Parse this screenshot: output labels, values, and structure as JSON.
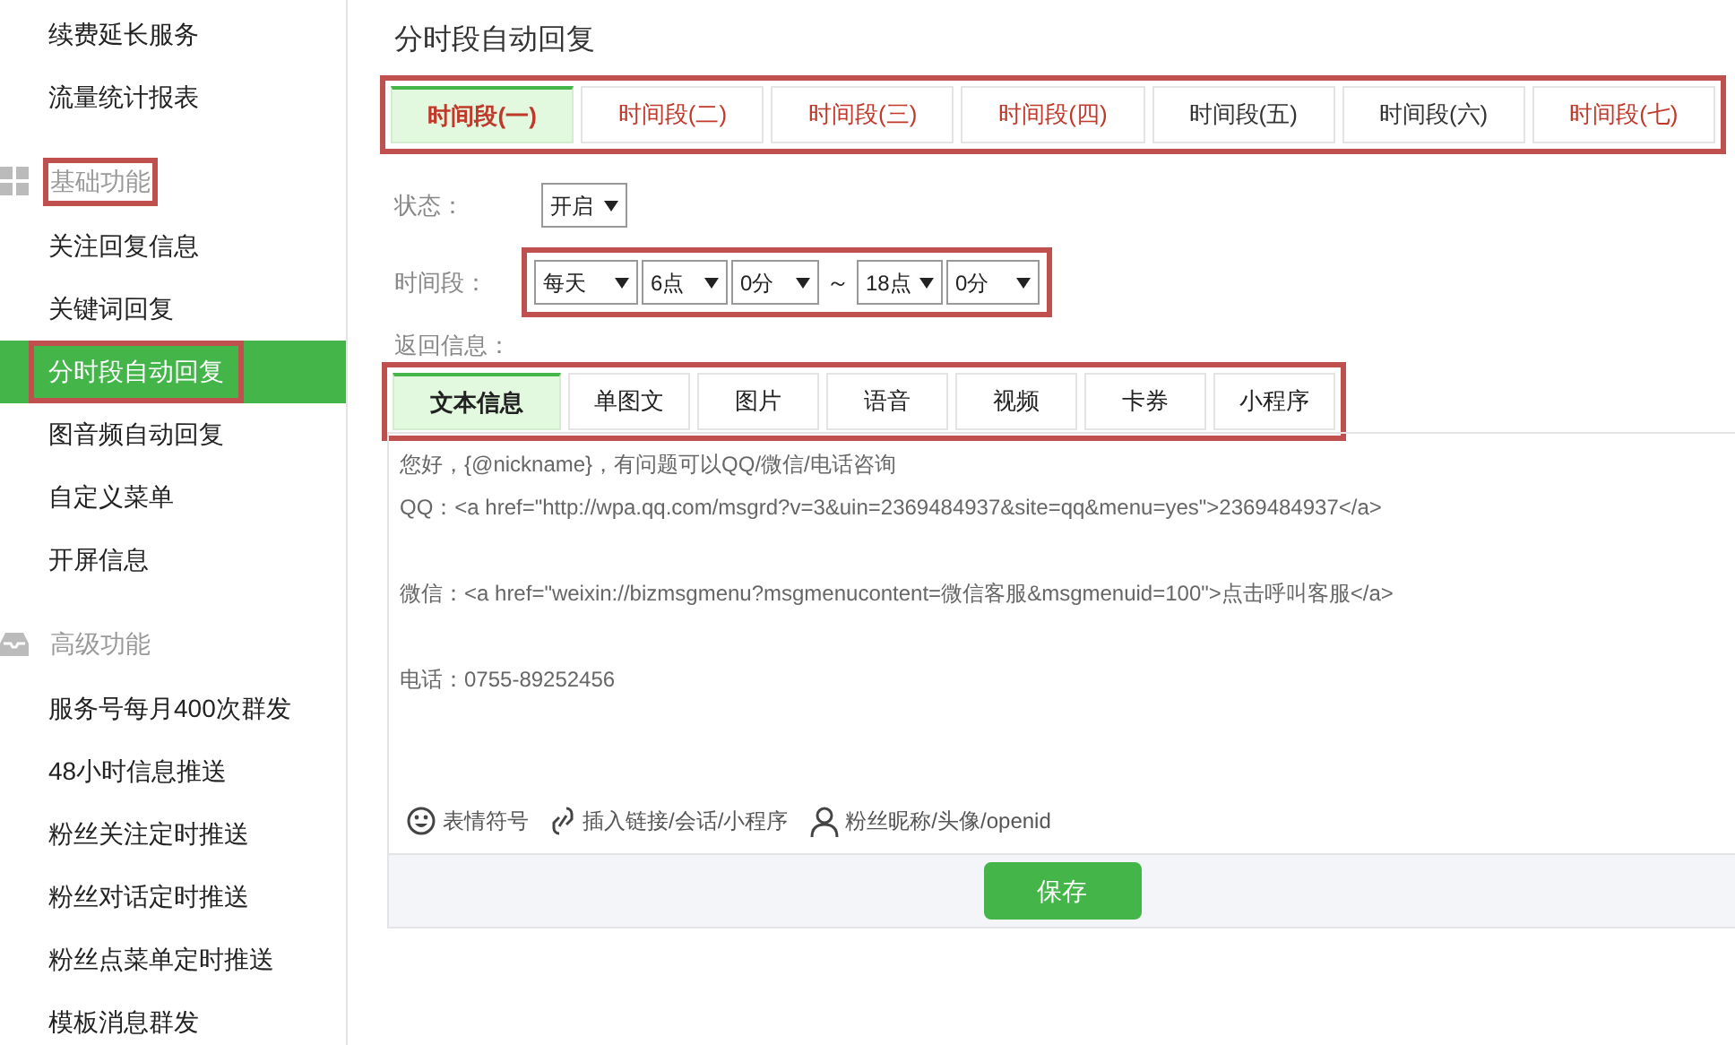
{
  "sidebar": {
    "groups": [
      {
        "items": [
          {
            "label": "续费延长服务",
            "selected": false,
            "highlighted": false
          },
          {
            "label": "流量统计报表",
            "selected": false,
            "highlighted": false
          }
        ]
      },
      {
        "title": "基础功能",
        "kind": "basic",
        "highlighted": true,
        "items": [
          {
            "label": "关注回复信息",
            "selected": false,
            "highlighted": false
          },
          {
            "label": "关键词回复",
            "selected": false,
            "highlighted": false
          },
          {
            "label": "分时段自动回复",
            "selected": true,
            "highlighted": true
          },
          {
            "label": "图音频自动回复",
            "selected": false,
            "highlighted": false
          },
          {
            "label": "自定义菜单",
            "selected": false,
            "highlighted": false
          },
          {
            "label": "开屏信息",
            "selected": false,
            "highlighted": false
          }
        ]
      },
      {
        "title": "高级功能",
        "kind": "advanced",
        "highlighted": false,
        "items": [
          {
            "label": "服务号每月400次群发",
            "selected": false,
            "highlighted": false
          },
          {
            "label": "48小时信息推送",
            "selected": false,
            "highlighted": false
          },
          {
            "label": "粉丝关注定时推送",
            "selected": false,
            "highlighted": false
          },
          {
            "label": "粉丝对话定时推送",
            "selected": false,
            "highlighted": false
          },
          {
            "label": "粉丝点菜单定时推送",
            "selected": false,
            "highlighted": false
          },
          {
            "label": "模板消息群发",
            "selected": false,
            "highlighted": false
          }
        ]
      }
    ]
  },
  "page_title": "分时段自动回复",
  "period_tabs": {
    "highlighted": true,
    "tabs": [
      {
        "label": "时间段(一)",
        "selected": true,
        "color": "#c0392b"
      },
      {
        "label": "时间段(二)",
        "selected": false,
        "color": "#c0392b"
      },
      {
        "label": "时间段(三)",
        "selected": false,
        "color": "#c0392b"
      },
      {
        "label": "时间段(四)",
        "selected": false,
        "color": "#c0392b"
      },
      {
        "label": "时间段(五)",
        "selected": false,
        "color": "#333333"
      },
      {
        "label": "时间段(六)",
        "selected": false,
        "color": "#333333"
      },
      {
        "label": "时间段(七)",
        "selected": false,
        "color": "#c0392b"
      }
    ]
  },
  "status": {
    "label": "状态：",
    "value": "开启"
  },
  "time_range": {
    "label": "时间段：",
    "highlighted": true,
    "start": [
      {
        "value": "每天"
      },
      {
        "value": "6点"
      },
      {
        "value": "0分"
      }
    ],
    "separator": "～",
    "end": [
      {
        "value": "18点"
      },
      {
        "value": "0分"
      }
    ]
  },
  "reply": {
    "label": "返回信息：",
    "highlighted": true,
    "tabs": [
      {
        "label": "文本信息",
        "selected": true
      },
      {
        "label": "单图文",
        "selected": false
      },
      {
        "label": "图片",
        "selected": false
      },
      {
        "label": "语音",
        "selected": false
      },
      {
        "label": "视频",
        "selected": false
      },
      {
        "label": "卡券",
        "selected": false
      },
      {
        "label": "小程序",
        "selected": false
      }
    ],
    "paragraphs": [
      {
        "lines": [
          "您好，{@nickname}，有问题可以QQ/微信/电话咨询",
          "QQ：<a href=\"http://wpa.qq.com/msgrd?v=3&uin=2369484937&site=qq&menu=yes\">2369484937</a>"
        ]
      },
      {
        "lines": [
          "微信：<a href=\"weixin://bizmsgmenu?msgmenucontent=微信客服&msgmenuid=100\">点击呼叫客服</a>"
        ]
      },
      {
        "lines": [
          "电话：0755-89252456"
        ]
      }
    ],
    "tools": [
      {
        "kind": "emoji",
        "label": "表情符号"
      },
      {
        "kind": "link",
        "label": "插入链接/会话/小程序"
      },
      {
        "kind": "user",
        "label": "粉丝昵称/头像/openid"
      }
    ]
  },
  "save_button": "保存"
}
